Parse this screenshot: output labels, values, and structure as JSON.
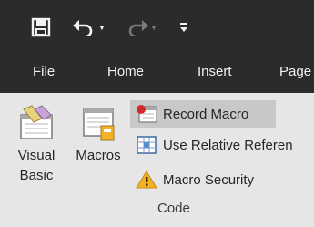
{
  "quick_access": {
    "save_icon": "save-icon",
    "undo_icon": "undo-icon",
    "redo_icon": "redo-icon",
    "customize_icon": "customize-qat-icon"
  },
  "tabs": [
    {
      "label": "File"
    },
    {
      "label": "Home"
    },
    {
      "label": "Insert"
    },
    {
      "label": "Page"
    }
  ],
  "code_group": {
    "visual_basic_label": "Visual\nBasic",
    "macros_label": "Macros",
    "record_macro_label": "Record Macro",
    "use_relative_label": "Use Relative Referen",
    "macro_security_label": "Macro Security",
    "group_label": "Code"
  },
  "colors": {
    "title_bar": "#2b2b2b",
    "ribbon": "#e6e6e6",
    "hover": "#c8c8c8",
    "warning": "#f3b223"
  }
}
